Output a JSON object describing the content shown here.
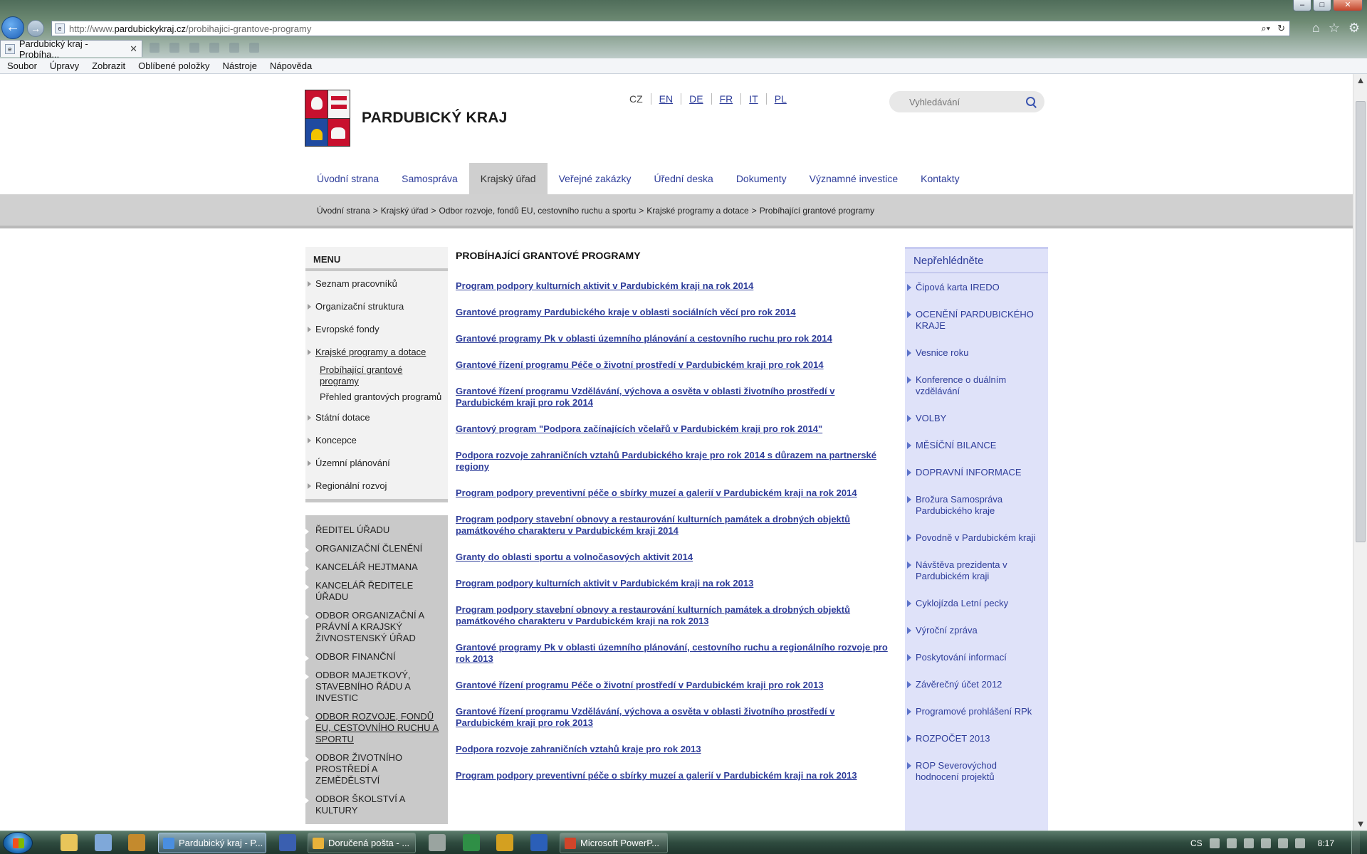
{
  "browser": {
    "window_controls": {
      "minimize": "–",
      "maximize": "□",
      "close": "✕"
    },
    "url_prefix": "http://www.",
    "url_domain": "pardubickykraj.cz",
    "url_path": "/probihajici-grantove-programy",
    "tab_title": "Pardubický kraj - Probíha...",
    "tab_close": "✕",
    "menu": [
      "Soubor",
      "Úpravy",
      "Zobrazit",
      "Oblíbené položky",
      "Nástroje",
      "Nápověda"
    ]
  },
  "site": {
    "title": "PARDUBICKÝ KRAJ",
    "languages": [
      "CZ",
      "EN",
      "DE",
      "FR",
      "IT",
      "PL"
    ],
    "search_placeholder": "Vyhledávání",
    "nav": [
      "Úvodní strana",
      "Samospráva",
      "Krajský úřad",
      "Veřejné zakázky",
      "Úřední deska",
      "Dokumenty",
      "Významné investice",
      "Kontakty"
    ],
    "breadcrumb": [
      "Úvodní strana",
      "Krajský úřad",
      "Odbor rozvoje, fondů EU, cestovního ruchu a sportu",
      "Krajské programy a dotace",
      "Probíhající grantové programy"
    ]
  },
  "left_menu": {
    "title": "MENU",
    "items": [
      "Seznam pracovníků",
      "Organizační struktura",
      "Evropské fondy",
      "Krajské programy a dotace"
    ],
    "subitems": [
      "Probíhající grantové programy",
      "Přehled grantových programů"
    ],
    "items_after": [
      "Státní dotace",
      "Koncepce",
      "Územní plánování",
      "Regionální rozvoj"
    ]
  },
  "departments": [
    "ŘEDITEL ÚŘADU",
    "ORGANIZAČNÍ ČLENĚNÍ",
    "KANCELÁŘ HEJTMANA",
    "KANCELÁŘ ŘEDITELE ÚŘADU",
    "ODBOR ORGANIZAČNÍ A PRÁVNÍ A KRAJSKÝ ŽIVNOSTENSKÝ ÚŘAD",
    "ODBOR FINANČNÍ",
    "ODBOR MAJETKOVÝ, STAVEBNÍHO ŘÁDU A INVESTIC",
    "ODBOR ROZVOJE, FONDŮ EU, CESTOVNÍHO RUCHU A SPORTU",
    "ODBOR ŽIVOTNÍHO PROSTŘEDÍ A ZEMĚDĚLSTVÍ",
    "ODBOR ŠKOLSTVÍ A KULTURY"
  ],
  "main": {
    "title": "PROBÍHAJÍCÍ GRANTOVÉ PROGRAMY",
    "programs": [
      "Program podpory kulturních aktivit v Pardubickém kraji na rok 2014",
      "Grantové programy Pardubického kraje v oblasti sociálních věcí pro rok 2014",
      "Grantové programy Pk v oblasti územního plánování a cestovního ruchu pro rok 2014",
      "Grantové řízení programu Péče o životní prostředí v Pardubickém kraji pro rok 2014",
      "Grantové řízení programu Vzdělávání, výchova a osvěta v oblasti životního prostředí v Pardubickém kraji pro rok 2014",
      "Grantový program \"Podpora začínajících včelařů v Pardubickém kraji pro rok 2014\"",
      "Podpora rozvoje zahraničních vztahů Pardubického kraje pro rok 2014 s důrazem na partnerské regiony",
      "Program podpory preventivní péče o sbírky muzeí a galerií v Pardubickém kraji na rok 2014",
      "Program podpory stavební obnovy a restaurování kulturních památek a drobných objektů památkového charakteru v Pardubickém kraji 2014",
      "Granty do oblasti sportu a volnočasových aktivit 2014",
      "Program podpory kulturních aktivit v Pardubickém kraji na rok 2013",
      "Program podpory stavební obnovy a restaurování kulturních památek a drobných objektů památkového charakteru v Pardubickém kraji na rok 2013",
      "Grantové programy Pk v oblasti územního plánování, cestovního ruchu a regionálního rozvoje pro rok 2013",
      "Grantové řízení programu Péče o životní prostředí v Pardubickém kraji pro rok 2013",
      "Grantové řízení programu Vzdělávání, výchova a osvěta v oblasti životního prostředí v Pardubickém kraji pro rok 2013",
      "Podpora rozvoje zahraničních vztahů kraje pro rok 2013",
      "Program podpory preventivní péče o sbírky muzeí a galerií v Pardubickém kraji na rok 2013"
    ]
  },
  "sidebar": {
    "title": "Nepřehlédněte",
    "links": [
      "Čipová karta IREDO",
      "OCENĚNÍ PARDUBICKÉHO KRAJE",
      "Vesnice roku",
      "Konference o duálním vzdělávání",
      "VOLBY",
      "MĚSÍČNÍ BILANCE",
      "DOPRAVNÍ INFORMACE",
      "Brožura Samospráva Pardubického kraje",
      "Povodně v Pardubickém kraji",
      "Návštěva prezidenta v Pardubickém kraji",
      "Cyklojízda Letní pecky",
      "Výroční zpráva",
      "Poskytování informací",
      "Závěrečný účet 2012",
      "Programové prohlášení RPk",
      "ROZPOČET 2013",
      "ROP Severovýchod hodnocení projektů"
    ]
  },
  "taskbar": {
    "tasks": [
      "Pardubický kraj - P...",
      "Doručená pošta - ...",
      "Microsoft PowerP..."
    ],
    "language": "CS",
    "clock": "8:17"
  },
  "colors": {
    "link": "#2e3d9a",
    "sidebar_bg": "#dfe2f9",
    "breadcrumb_bg": "#d0d0d0"
  }
}
